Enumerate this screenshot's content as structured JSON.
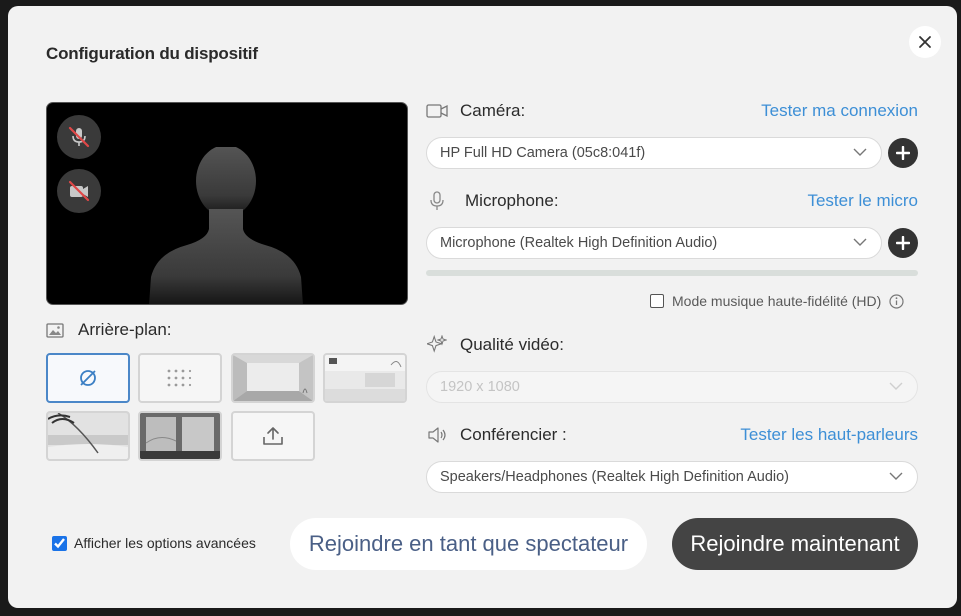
{
  "dialog": {
    "title": "Configuration du dispositif"
  },
  "preview": {
    "mic_muted": true,
    "camera_off": true
  },
  "background": {
    "label": "Arrière-plan:",
    "options": [
      {
        "name": "none",
        "selected": true
      },
      {
        "name": "blur",
        "selected": false
      },
      {
        "name": "empty-room",
        "selected": false
      },
      {
        "name": "office",
        "selected": false
      },
      {
        "name": "beach",
        "selected": false
      },
      {
        "name": "window-view",
        "selected": false
      },
      {
        "name": "upload",
        "selected": false
      }
    ]
  },
  "camera": {
    "label": "Caméra:",
    "test_link": "Tester ma connexion",
    "selected": "HP Full HD Camera (05c8:041f)"
  },
  "microphone": {
    "label": "Microphone:",
    "test_link": "Tester le micro",
    "selected": "Microphone (Realtek High Definition Audio)",
    "level": 0
  },
  "hd_mode": {
    "label": "Mode musique haute-fidélité (HD)",
    "checked": false
  },
  "video_quality": {
    "label": "Qualité vidéo:",
    "selected": "1920 x 1080"
  },
  "speaker": {
    "label": "Conférencier :",
    "test_link": "Tester les haut-parleurs",
    "selected": "Speakers/Headphones (Realtek High Definition Audio)"
  },
  "advanced": {
    "label": "Afficher les options avancées",
    "checked": true
  },
  "actions": {
    "spectator": "Rejoindre en tant que spectateur",
    "join": "Rejoindre maintenant"
  },
  "colors": {
    "accent_link": "#3d8fd6",
    "primary_button": "#444444",
    "selected_border": "#4b87c8"
  }
}
